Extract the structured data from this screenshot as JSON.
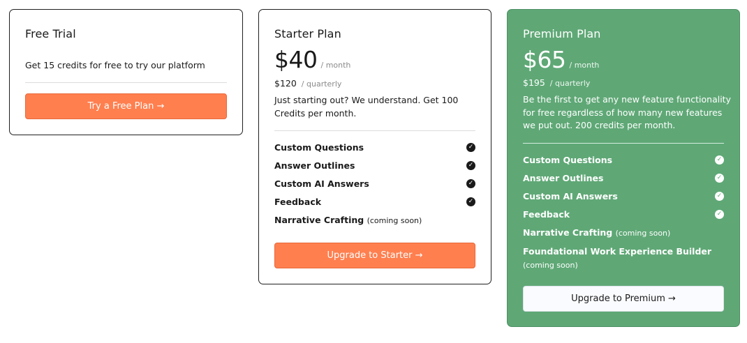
{
  "free": {
    "title": "Free Trial",
    "description": "Get 15 credits for free to try our platform",
    "button_label": "Try a Free Plan →"
  },
  "starter": {
    "title": "Starter Plan",
    "price": "$40",
    "per": "/ month",
    "quarterly_price": "$120",
    "quarterly_per": "/ quarterly",
    "description": "Just starting out? We understand. Get 100 Credits per month.",
    "features": [
      {
        "label": "Custom Questions",
        "note": "",
        "included": true
      },
      {
        "label": "Answer Outlines",
        "note": "",
        "included": true
      },
      {
        "label": "Custom AI Answers",
        "note": "",
        "included": true
      },
      {
        "label": "Feedback",
        "note": "",
        "included": true
      },
      {
        "label": "Narrative Crafting",
        "note": "(coming soon)",
        "included": false
      }
    ],
    "button_label": "Upgrade to Starter →"
  },
  "premium": {
    "title": "Premium Plan",
    "price": "$65",
    "per": "/ month",
    "quarterly_price": "$195",
    "quarterly_per": "/ quarterly",
    "description": "Be the first to get any new feature functionality for free regardless of how many new features we put out. 200 credits per month.",
    "features": [
      {
        "label": "Custom Questions",
        "note": "",
        "included": true
      },
      {
        "label": "Answer Outlines",
        "note": "",
        "included": true
      },
      {
        "label": "Custom AI Answers",
        "note": "",
        "included": true
      },
      {
        "label": "Feedback",
        "note": "",
        "included": true
      },
      {
        "label": "Narrative Crafting",
        "note": "(coming soon)",
        "included": false
      },
      {
        "label": "Foundational Work Experience Builder",
        "note": "(coming soon)",
        "included": false
      }
    ],
    "button_label": "Upgrade to Premium →"
  },
  "check_icon": "check-circle-icon",
  "colors": {
    "accent_orange": "#ff7f4f",
    "premium_green": "#5fa876"
  }
}
